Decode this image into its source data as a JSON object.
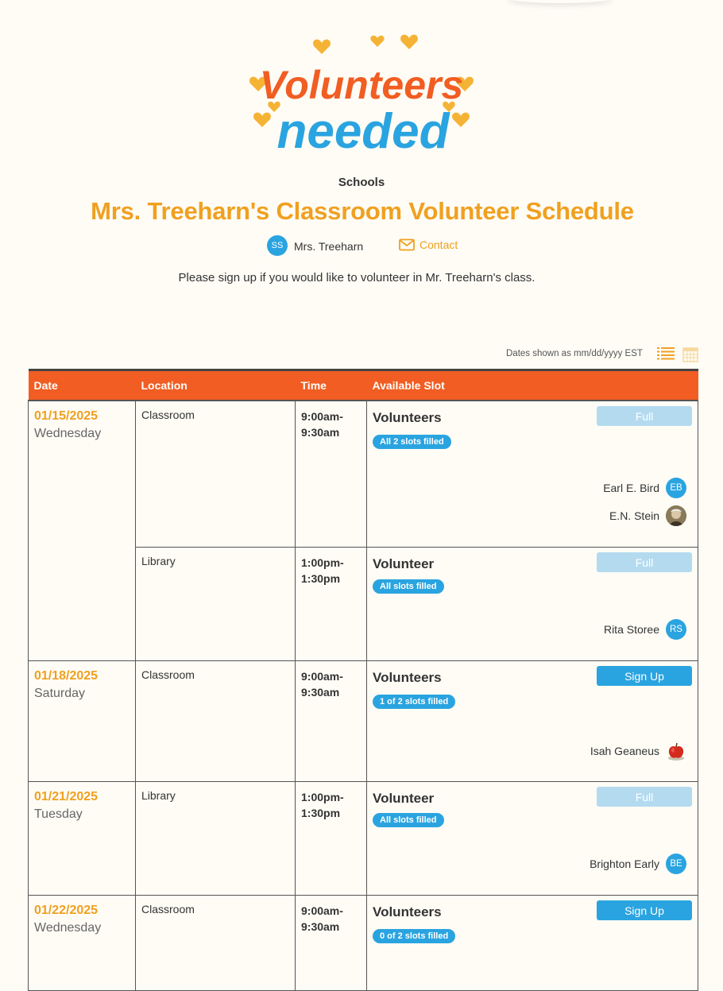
{
  "logo": {
    "line1": "Volunteers",
    "line2": "needed",
    "colors": {
      "line1": "#f15d22",
      "line2": "#2aa4e0",
      "hearts": "#f5b335"
    }
  },
  "header": {
    "category": "Schools",
    "title": "Mrs. Treeharn's Classroom Volunteer Schedule",
    "organizer": {
      "initials": "SS",
      "name": "Mrs. Treeharn"
    },
    "contact_label": "Contact",
    "description": "Please sign up if you would like to volunteer in Mr. Treeharn's class."
  },
  "view": {
    "dates_note": "Dates shown as mm/dd/yyyy EST",
    "icons": [
      "list-view-icon",
      "calendar-view-icon"
    ]
  },
  "table": {
    "columns": [
      "Date",
      "Location",
      "Time",
      "Available Slot"
    ],
    "dates": [
      {
        "date": "01/15/2025",
        "day": "Wednesday",
        "slots": [
          {
            "location": "Classroom",
            "time_start": "9:00am-",
            "time_end": "9:30am",
            "title": "Volunteers",
            "badge": "All 2 slots filled",
            "button": "Full",
            "status": "full",
            "volunteers": [
              {
                "name": "Earl E. Bird",
                "initials": "EB",
                "avatar": "initials"
              },
              {
                "name": "E.N. Stein",
                "initials": "",
                "avatar": "photo"
              }
            ]
          },
          {
            "location": "Library",
            "time_start": "1:00pm-",
            "time_end": "1:30pm",
            "title": "Volunteer",
            "badge": "All slots filled",
            "button": "Full",
            "status": "full",
            "volunteers": [
              {
                "name": "Rita Storee",
                "initials": "RS",
                "avatar": "initials"
              }
            ]
          }
        ]
      },
      {
        "date": "01/18/2025",
        "day": "Saturday",
        "slots": [
          {
            "location": "Classroom",
            "time_start": "9:00am-",
            "time_end": "9:30am",
            "title": "Volunteers",
            "badge": "1 of 2 slots filled",
            "button": "Sign Up",
            "status": "open",
            "volunteers": [
              {
                "name": "Isah Geaneus",
                "initials": "",
                "avatar": "apple"
              }
            ]
          }
        ]
      },
      {
        "date": "01/21/2025",
        "day": "Tuesday",
        "slots": [
          {
            "location": "Library",
            "time_start": "1:00pm-",
            "time_end": "1:30pm",
            "title": "Volunteer",
            "badge": "All slots filled",
            "button": "Full",
            "status": "full",
            "volunteers": [
              {
                "name": "Brighton Early",
                "initials": "BE",
                "avatar": "initials"
              }
            ]
          }
        ]
      },
      {
        "date": "01/22/2025",
        "day": "Wednesday",
        "slots": [
          {
            "location": "Classroom",
            "time_start": "9:00am-",
            "time_end": "9:30am",
            "title": "Volunteers",
            "badge": "0 of 2 slots filled",
            "button": "Sign Up",
            "status": "open",
            "volunteers": []
          }
        ]
      }
    ]
  }
}
